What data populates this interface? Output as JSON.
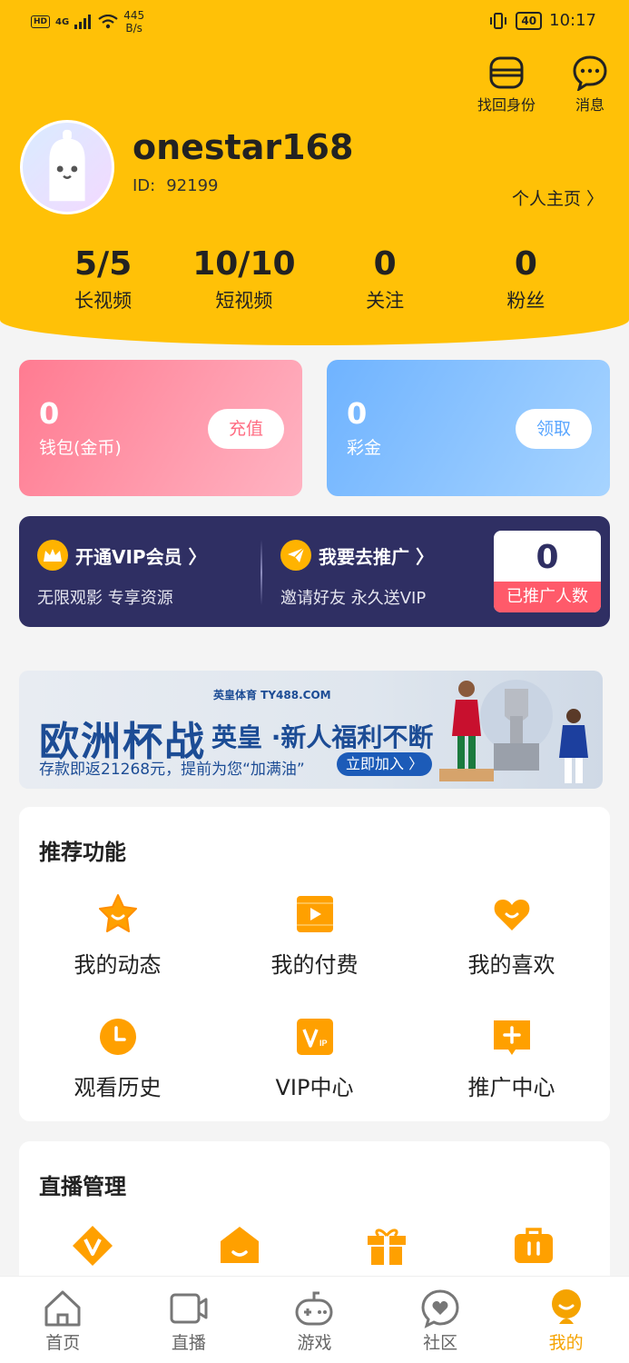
{
  "status_bar": {
    "hd": "HD",
    "network": "4G",
    "speed_value": "445",
    "speed_unit": "B/s",
    "battery": "40",
    "time": "10:17"
  },
  "top_actions": {
    "restore_identity": "找回身份",
    "messages": "消息"
  },
  "profile": {
    "username": "onestar168",
    "id_label": "ID:",
    "id_value": "92199",
    "homepage_link": "个人主页 〉"
  },
  "stats": [
    {
      "value": "5/5",
      "label": "长视频"
    },
    {
      "value": "10/10",
      "label": "短视频"
    },
    {
      "value": "0",
      "label": "关注"
    },
    {
      "value": "0",
      "label": "粉丝"
    }
  ],
  "wallet": {
    "coins_value": "0",
    "coins_label": "钱包(金币)",
    "recharge_button": "充值",
    "bonus_value": "0",
    "bonus_label": "彩金",
    "claim_button": "领取"
  },
  "vip_bar": {
    "vip_title": "开通VIP会员 〉",
    "vip_sub": "无限观影 专享资源",
    "promote_title": "我要去推广 〉",
    "promote_sub": "邀请好友 永久送VIP",
    "promoted_count": "0",
    "promoted_label": "已推广人数"
  },
  "banner": {
    "brand": "英皇体育 TY488.COM",
    "title": "欧洲杯战",
    "slogan": "英皇 ·新人福利不断",
    "sub": "存款即返21268元，提前为您“加满油”",
    "button": "立即加入 〉"
  },
  "recommend": {
    "title": "推荐功能",
    "items": [
      {
        "label": "我的动态",
        "icon": "star-icon"
      },
      {
        "label": "我的付费",
        "icon": "play-icon"
      },
      {
        "label": "我的喜欢",
        "icon": "heart-icon"
      },
      {
        "label": "观看历史",
        "icon": "clock-icon"
      },
      {
        "label": "VIP中心",
        "icon": "vip-icon"
      },
      {
        "label": "推广中心",
        "icon": "plus-icon"
      }
    ]
  },
  "live": {
    "title": "直播管理"
  },
  "bottom_nav": [
    {
      "label": "首页",
      "icon": "home-icon"
    },
    {
      "label": "直播",
      "icon": "video-icon"
    },
    {
      "label": "游戏",
      "icon": "gamepad-icon"
    },
    {
      "label": "社区",
      "icon": "community-icon"
    },
    {
      "label": "我的",
      "icon": "profile-icon",
      "active": true
    }
  ],
  "colors": {
    "header_yellow": "#FFC107",
    "accent_orange": "#f5a300",
    "vip_navy": "#2f2f63"
  }
}
